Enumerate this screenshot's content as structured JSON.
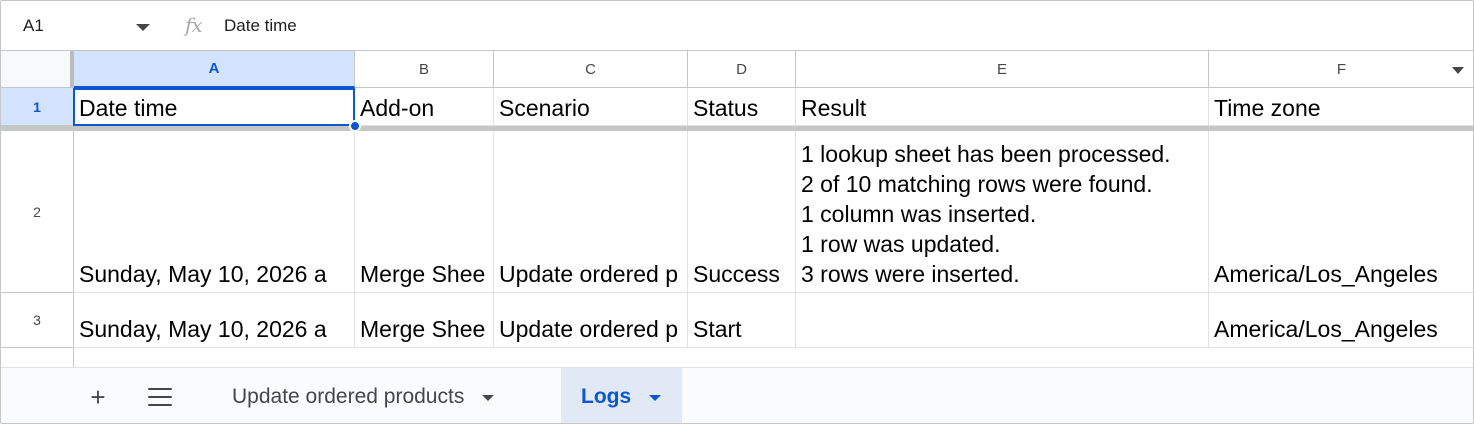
{
  "formula_bar": {
    "name_box": "A1",
    "fx_label": "fx",
    "value": "Date time"
  },
  "columns": [
    "A",
    "B",
    "C",
    "D",
    "E",
    "F"
  ],
  "rows": [
    "1",
    "2",
    "3"
  ],
  "cells": {
    "r1": [
      "Date time",
      "Add-on",
      "Scenario",
      "Status",
      "Result",
      "Time zone"
    ],
    "r2": {
      "a": "Sunday, May 10, 2026 a",
      "b": "Merge Shee",
      "c": "Update ordered p",
      "d": "Success",
      "e": [
        "1 lookup sheet has been processed.",
        "2 of 10 matching rows were found.",
        "1 column was inserted.",
        "1 row was updated.",
        "3 rows were inserted."
      ],
      "f": "America/Los_Angeles"
    },
    "r3": {
      "a": "Sunday, May 10, 2026 a",
      "b": "Merge Shee",
      "c": "Update ordered p",
      "d": "Start",
      "e": "",
      "f": "America/Los_Angeles"
    }
  },
  "sheet_tabs": [
    {
      "label": "Update ordered products",
      "active": false
    },
    {
      "label": "Logs",
      "active": true
    }
  ],
  "icons": {
    "add_sheet": "plus-icon",
    "all_sheets": "menu-icon",
    "dropdown": "caret-down-icon"
  },
  "colors": {
    "selection": "#0b57d0",
    "selected_header_bg": "#d3e3fd",
    "active_tab_bg": "#e1e9f7"
  }
}
